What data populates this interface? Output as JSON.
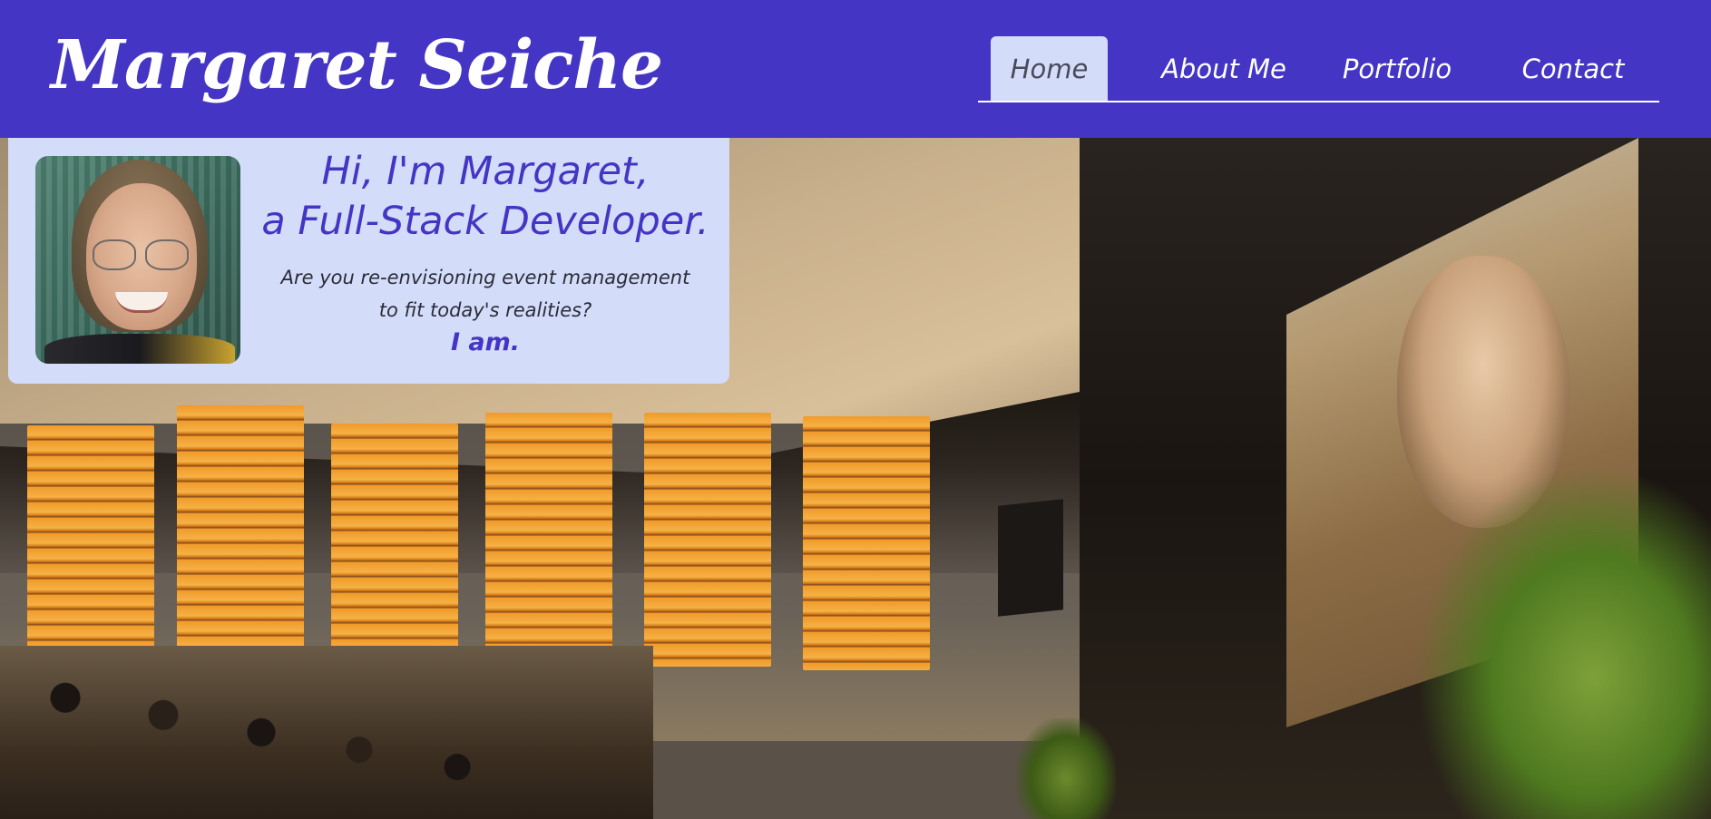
{
  "header": {
    "brand": "Margaret Seiche",
    "nav": [
      {
        "label": "Home",
        "active": true
      },
      {
        "label": "About Me",
        "active": false
      },
      {
        "label": "Portfolio",
        "active": false
      },
      {
        "label": "Contact",
        "active": false
      }
    ]
  },
  "intro": {
    "greeting_line1": "Hi, I'm Margaret,",
    "greeting_line2": "a Full-Stack Developer.",
    "question_line1": "Are you re-envisioning event management",
    "question_line2": "to fit today's realities?",
    "answer": "I am."
  },
  "colors": {
    "header_bg": "#4435c4",
    "accent": "#4435c4",
    "card_bg": "#d3dcf9",
    "active_tab_bg": "#d3dcf9"
  }
}
